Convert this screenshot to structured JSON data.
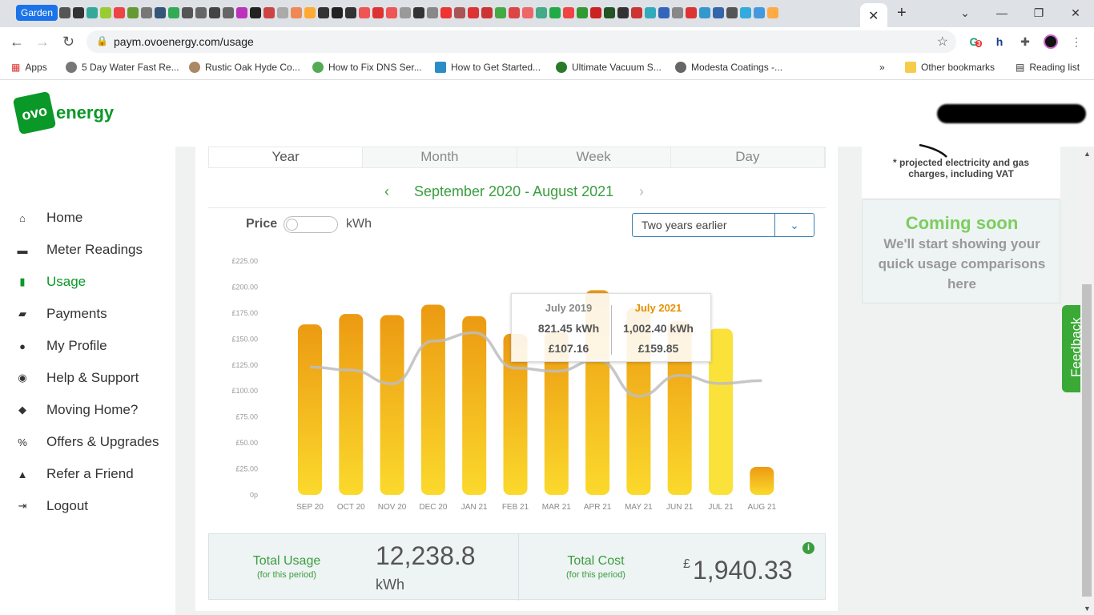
{
  "browser": {
    "tab_group": "Garden",
    "url": "paym.ovoenergy.com/usage",
    "extension_badge": "3",
    "bookmarks": [
      {
        "label": "Apps"
      },
      {
        "label": "5 Day Water Fast Re..."
      },
      {
        "label": "Rustic Oak Hyde Co..."
      },
      {
        "label": "How to Fix DNS Ser..."
      },
      {
        "label": "How to Get Started..."
      },
      {
        "label": "Ultimate Vacuum S..."
      },
      {
        "label": "Modesta Coatings -..."
      }
    ],
    "bookmarks_more": "»",
    "other_bookmarks": "Other bookmarks",
    "reading_list": "Reading list"
  },
  "brand": {
    "logo_text": "ovo",
    "logo_word": "energy"
  },
  "sidebar": {
    "items": [
      {
        "label": "Home",
        "icon": "home-icon"
      },
      {
        "label": "Meter Readings",
        "icon": "meter-icon"
      },
      {
        "label": "Usage",
        "icon": "usage-chart-icon"
      },
      {
        "label": "Payments",
        "icon": "wallet-icon"
      },
      {
        "label": "My Profile",
        "icon": "person-icon"
      },
      {
        "label": "Help & Support",
        "icon": "support-icon"
      },
      {
        "label": "Moving Home?",
        "icon": "moving-icon"
      },
      {
        "label": "Offers & Upgrades",
        "icon": "offers-icon"
      },
      {
        "label": "Refer a Friend",
        "icon": "refer-icon"
      },
      {
        "label": "Logout",
        "icon": "logout-icon"
      }
    ]
  },
  "usage": {
    "tabs": [
      "Year",
      "Month",
      "Week",
      "Day"
    ],
    "selected_tab": "Year",
    "period": "September 2020 - August 2021",
    "price_label": "Price",
    "kwh_label": "kWh",
    "compare_select": "Two years earlier",
    "tooltip": {
      "left": {
        "header": "July 2019",
        "kwh": "821.45 kWh",
        "price": "£107.16"
      },
      "right": {
        "header": "July 2021",
        "kwh": "1,002.40 kWh",
        "price": "£159.85"
      }
    },
    "totals": {
      "usage_label": "Total Usage",
      "usage_sub": "(for this period)",
      "usage_value": "12,238.8",
      "usage_unit": "kWh",
      "cost_label": "Total Cost",
      "cost_sub": "(for this period)",
      "cost_currency": "£",
      "cost_value": "1,940.33"
    }
  },
  "right_panel": {
    "note": "* projected electricity and gas charges, including VAT",
    "soon_title": "Coming soon",
    "soon_body": "We'll start showing your quick usage comparisons here",
    "feedback": "Feedback"
  },
  "colors": {
    "brand_green": "#0a9828",
    "text_green": "#3a9e3f",
    "bar_top": "#ec9a12",
    "bar_bottom": "#fbd92c",
    "comparison_line": "#cccccc"
  },
  "chart_data": {
    "type": "bar",
    "categories": [
      "SEP 20",
      "OCT 20",
      "NOV 20",
      "DEC 20",
      "JAN 21",
      "FEB 21",
      "MAR 21",
      "APR 21",
      "MAY 21",
      "JUN 21",
      "JUL 21",
      "AUG 21"
    ],
    "y_ticks": [
      "0p",
      "£25.00",
      "£50.00",
      "£75.00",
      "£100.00",
      "£125.00",
      "£150.00",
      "£175.00",
      "£200.00",
      "£225.00"
    ],
    "ylim": [
      0,
      225
    ],
    "series": [
      {
        "values": [
          164,
          174,
          173,
          183,
          172,
          155,
          157,
          197,
          180,
          167,
          159.85,
          27
        ]
      },
      {
        "type": "line",
        "values": [
          123,
          120,
          107,
          148,
          156,
          122,
          119,
          130,
          95,
          115,
          107.16,
          110
        ]
      }
    ]
  }
}
